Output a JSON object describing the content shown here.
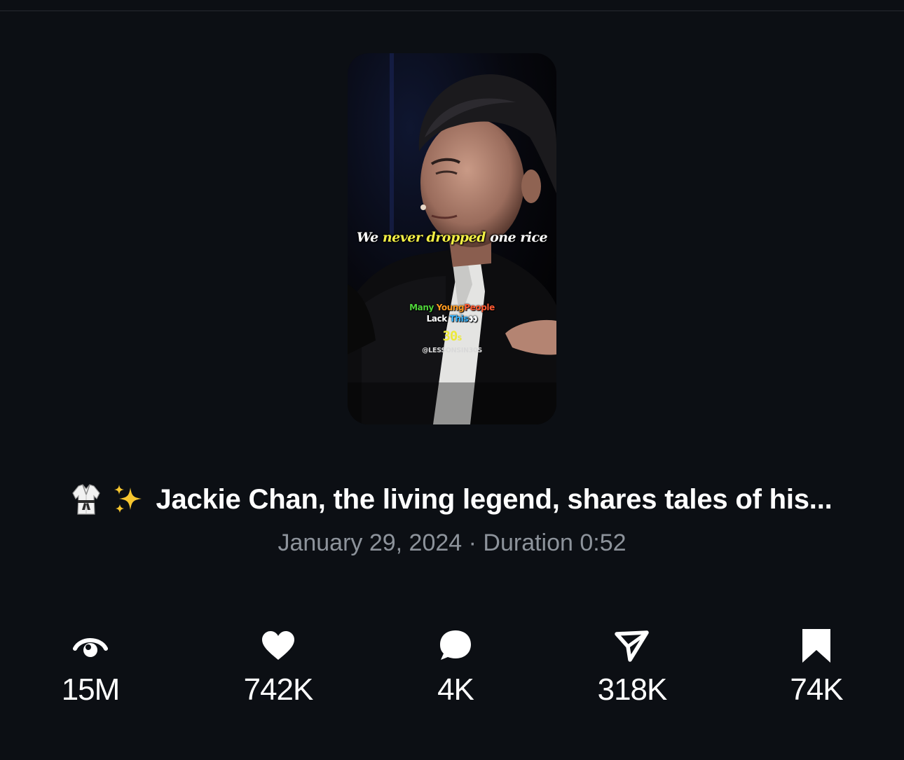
{
  "video": {
    "caption": {
      "word1": "We",
      "word2": "never dropped",
      "word3": "one rice"
    },
    "overlay": {
      "line1_a": "Many",
      "line1_b": "Young",
      "line1_c": "People",
      "line2_a": "Lack",
      "line2_b": "This",
      "line2_eyes": "👀",
      "timer": "30",
      "timer_unit": "s",
      "handle": "@LESSONSIN30S"
    }
  },
  "post": {
    "emoji_icons": [
      "martial-arts-uniform-icon",
      "sparkles-icon"
    ],
    "title": "Jackie Chan, the living legend, shares tales of his...",
    "meta": "January 29, 2024 · Duration 0:52"
  },
  "stats": {
    "views": {
      "icon": "views-eye-icon",
      "value": "15M"
    },
    "likes": {
      "icon": "heart-icon",
      "value": "742K"
    },
    "comments": {
      "icon": "comment-bubble-icon",
      "value": "4K"
    },
    "shares": {
      "icon": "share-paper-plane-icon",
      "value": "318K"
    },
    "bookmarks": {
      "icon": "bookmark-icon",
      "value": "74K"
    }
  }
}
